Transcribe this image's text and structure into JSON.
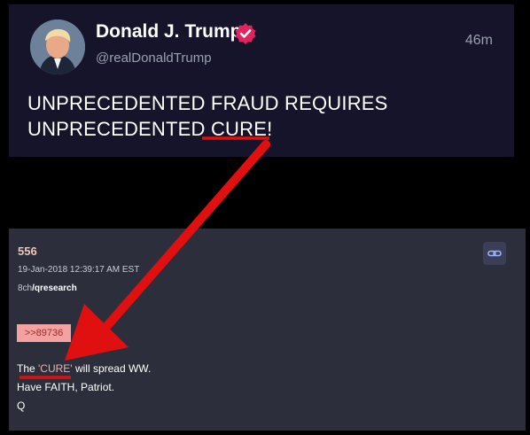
{
  "tweet": {
    "display_name": "Donald J. Trump",
    "handle": "@realDonaldTrump",
    "time": "46m",
    "text_line1": "UNPRECEDENTED FRAUD REQUIRES",
    "text_line2_prefix": "UNPRECEDENTED ",
    "text_line2_highlight": "CURE!",
    "verified_color": "#e0245e"
  },
  "post": {
    "number": "556",
    "date": "19-Jan-2018 12:39:17 AM EST",
    "board_prefix": "8ch",
    "board_name": "/qresearch",
    "reply_link": ">>89736",
    "body_line1_prefix": "The ",
    "body_line1_highlight": "'CURE'",
    "body_line1_suffix": " will spread WW.",
    "body_line2": "Have FAITH, Patriot.",
    "body_line3": "Q",
    "link_icon": "link-icon"
  },
  "annotation": {
    "color": "#e01010",
    "type": "arrow"
  }
}
